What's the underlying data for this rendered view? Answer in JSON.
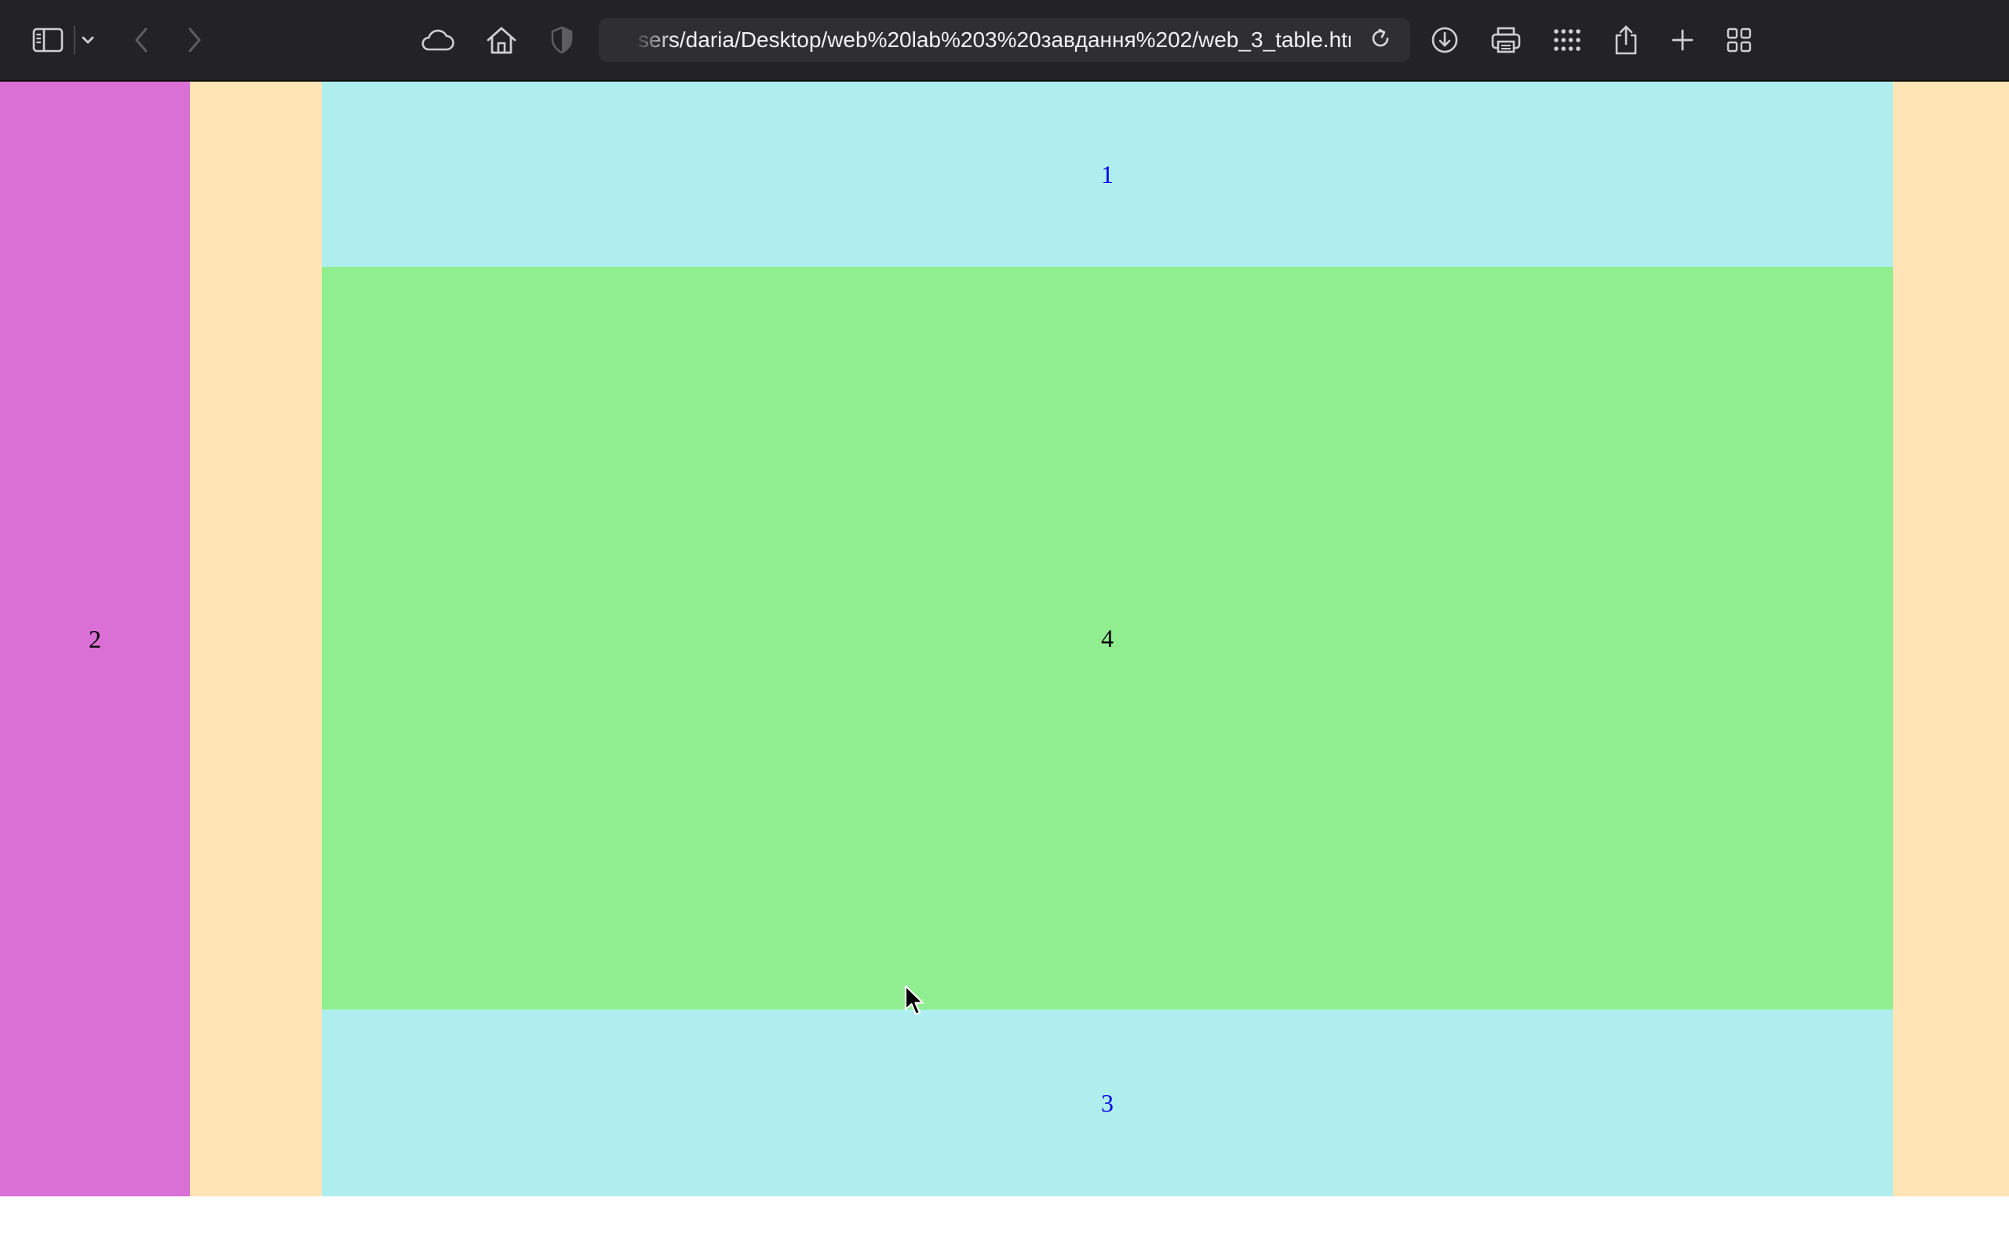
{
  "browser": {
    "address_bar": {
      "url": "sers/daria/Desktop/web%20lab%203%20завдання%202/web_3_table.html"
    },
    "toolbar_icons": [
      "sidebar-icon",
      "chevron-down-icon",
      "back-arrow-icon",
      "forward-arrow-icon",
      "cloud-icon",
      "home-icon",
      "shield-icon",
      "reload-icon",
      "download-icon",
      "print-icon",
      "apps-grid-icon",
      "share-icon",
      "plus-icon",
      "tab-overview-icon"
    ]
  },
  "page": {
    "cells": {
      "top": {
        "label": "1",
        "color": "#afeeee",
        "text_color": "#0000ee"
      },
      "left": {
        "label": "2",
        "color": "#da70d6",
        "text_color": "#000000"
      },
      "bottom": {
        "label": "3",
        "color": "#afeeee",
        "text_color": "#0000ee"
      },
      "center": {
        "label": "4",
        "color": "#90ee90",
        "text_color": "#000000"
      }
    },
    "padding_color": "#ffe4b5"
  }
}
